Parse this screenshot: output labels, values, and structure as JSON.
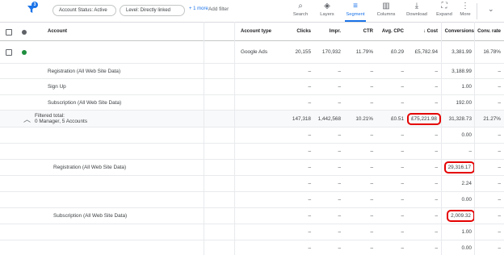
{
  "toolbar": {
    "filter_badge": "3",
    "chips": [
      "Account Status: Active",
      "Level: Directly linked"
    ],
    "more_link": "+ 1 more",
    "add_filter": "Add filter",
    "tools": [
      {
        "icon": "search-icon",
        "label": "Search",
        "active": false
      },
      {
        "icon": "layers-icon",
        "label": "Layers",
        "active": false
      },
      {
        "icon": "segment-icon",
        "label": "Segment",
        "active": true
      },
      {
        "icon": "columns-icon",
        "label": "Columns",
        "active": false
      },
      {
        "icon": "download-icon",
        "label": "Download",
        "active": false
      },
      {
        "icon": "expand-icon",
        "label": "Expand",
        "active": false
      },
      {
        "icon": "more-vert-icon",
        "label": "More",
        "active": false
      }
    ]
  },
  "table": {
    "headers": {
      "account": "Account",
      "account_type": "Account type",
      "clicks": "Clicks",
      "impr": "Impr.",
      "ctr": "CTR",
      "avg_cpc": "Avg. CPC",
      "cost": "↓ Cost",
      "conversions": "Conversions",
      "conv_rate": "Conv. rate"
    },
    "account_row": {
      "account_type": "Google Ads",
      "clicks": "20,155",
      "impr": "170,932",
      "ctr": "11.79%",
      "avg_cpc": "£0.29",
      "cost": "£5,782.94",
      "conversions": "3,381.99",
      "conv_rate": "16.78%"
    },
    "segment_rows": [
      {
        "label": "Registration (All Web Site Data)",
        "conversions": "3,188.99",
        "conv_rate": "–"
      },
      {
        "label": "Sign Up",
        "conversions": "1.00",
        "conv_rate": "–"
      },
      {
        "label": "Subscription (All Web Site Data)",
        "conversions": "192.00",
        "conv_rate": "–"
      }
    ],
    "filtered_total": {
      "label": "Filtered total:",
      "sublabel": "0 Manager, 5 Accounts",
      "clicks": "147,318",
      "impr": "1,442,568",
      "ctr": "10.21%",
      "avg_cpc": "£0.51",
      "cost": "£75,221.98",
      "conversions": "31,328.73",
      "conv_rate": "21.27%"
    },
    "total_segments": [
      {
        "label": "",
        "conversions": "0.00"
      },
      {
        "label": "",
        "conversions": "–"
      },
      {
        "label": "Registration (All Web Site Data)",
        "conversions": "29,316.17"
      },
      {
        "label": "",
        "conversions": "2.24"
      },
      {
        "label": "",
        "conversions": "0.00"
      },
      {
        "label": "Subscription (All Web Site Data)",
        "conversions": "2,009.32"
      },
      {
        "label": "",
        "conversions": "1.00"
      },
      {
        "label": "",
        "conversions": "0.00"
      }
    ],
    "dash": "–"
  },
  "colors": {
    "accent": "#1a73e8",
    "highlight": "#e50000",
    "status_green": "#1e8e3e"
  }
}
